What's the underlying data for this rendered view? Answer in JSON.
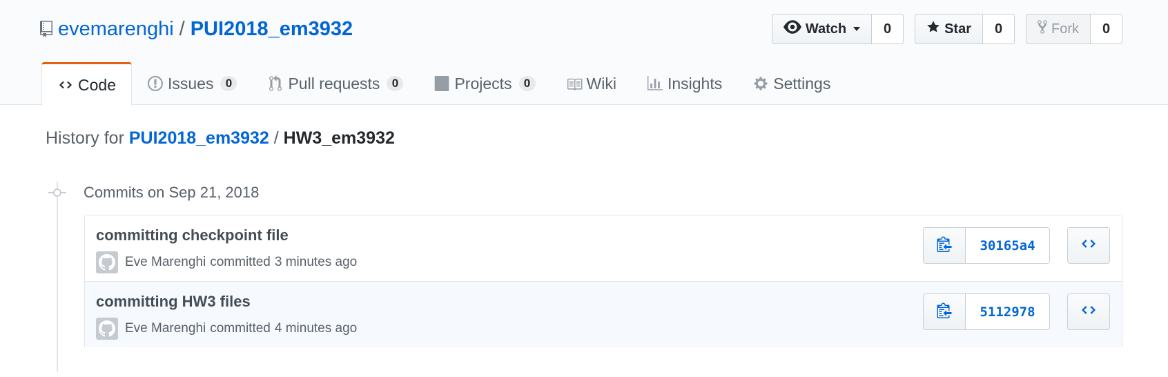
{
  "repo": {
    "owner": "evemarenghi",
    "separator": "/",
    "name": "PUI2018_em3932"
  },
  "actions": {
    "watch": {
      "label": "Watch",
      "count": "0"
    },
    "star": {
      "label": "Star",
      "count": "0"
    },
    "fork": {
      "label": "Fork",
      "count": "0"
    }
  },
  "tabs": [
    {
      "label": "Code",
      "icon": "code-icon"
    },
    {
      "label": "Issues",
      "count": "0",
      "icon": "issue-icon"
    },
    {
      "label": "Pull requests",
      "count": "0",
      "icon": "pull-request-icon"
    },
    {
      "label": "Projects",
      "count": "0",
      "icon": "project-icon"
    },
    {
      "label": "Wiki",
      "icon": "book-icon"
    },
    {
      "label": "Insights",
      "icon": "graph-icon"
    },
    {
      "label": "Settings",
      "icon": "gear-icon"
    }
  ],
  "history": {
    "prefix": "History for",
    "repo_link": "PUI2018_em3932",
    "separator": "/",
    "path": "HW3_em3932"
  },
  "commit_group": {
    "date_label": "Commits on Sep 21, 2018"
  },
  "commits": [
    {
      "title": "committing checkpoint file",
      "author": "Eve Marenghi",
      "verb": "committed",
      "time": "3 minutes ago",
      "sha": "30165a4"
    },
    {
      "title": "committing HW3 files",
      "author": "Eve Marenghi",
      "verb": "committed",
      "time": "4 minutes ago",
      "sha": "5112978"
    }
  ],
  "colors": {
    "link": "#0366d6",
    "selected_tab_accent": "#e36209"
  }
}
